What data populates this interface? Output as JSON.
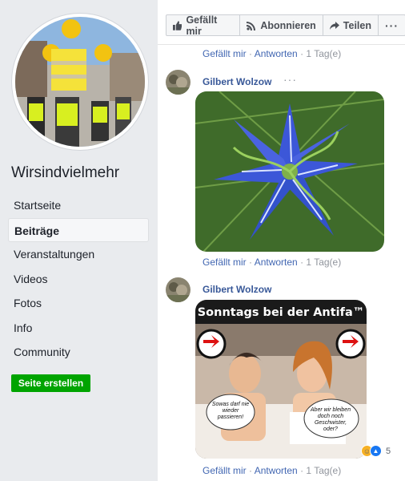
{
  "sidebar": {
    "page_name": "Wirsindvielmehr",
    "nav": [
      {
        "label": "Startseite"
      },
      {
        "label": "Beiträge",
        "active": true
      },
      {
        "label": "Veranstaltungen"
      },
      {
        "label": "Videos"
      },
      {
        "label": "Fotos"
      },
      {
        "label": "Info"
      },
      {
        "label": "Community"
      }
    ],
    "create_button": "Seite erstellen"
  },
  "actions": {
    "like": "Gefällt mir",
    "subscribe": "Abonnieren",
    "share": "Teilen"
  },
  "meta": {
    "like": "Gefällt mir",
    "reply": "Antworten",
    "sep": " · ",
    "time": "1 Tag(e)"
  },
  "comments": [
    {
      "author": "Gilbert Wolzow",
      "image": "blue-flower-photo"
    },
    {
      "author": "Gilbert Wolzow",
      "image": "meme-sonntags-bei-der-antifa",
      "meme_title": "Sonntags bei der Antifa™",
      "bubble_left": "Sowas darf nie wieder passieren!",
      "bubble_right": "Aber wir bleiben doch noch Geschwister, oder?",
      "reaction_count": "5"
    }
  ],
  "colors": {
    "accent": "#4267b2",
    "create": "#00a400",
    "sidebar_bg": "#e9ebee"
  }
}
